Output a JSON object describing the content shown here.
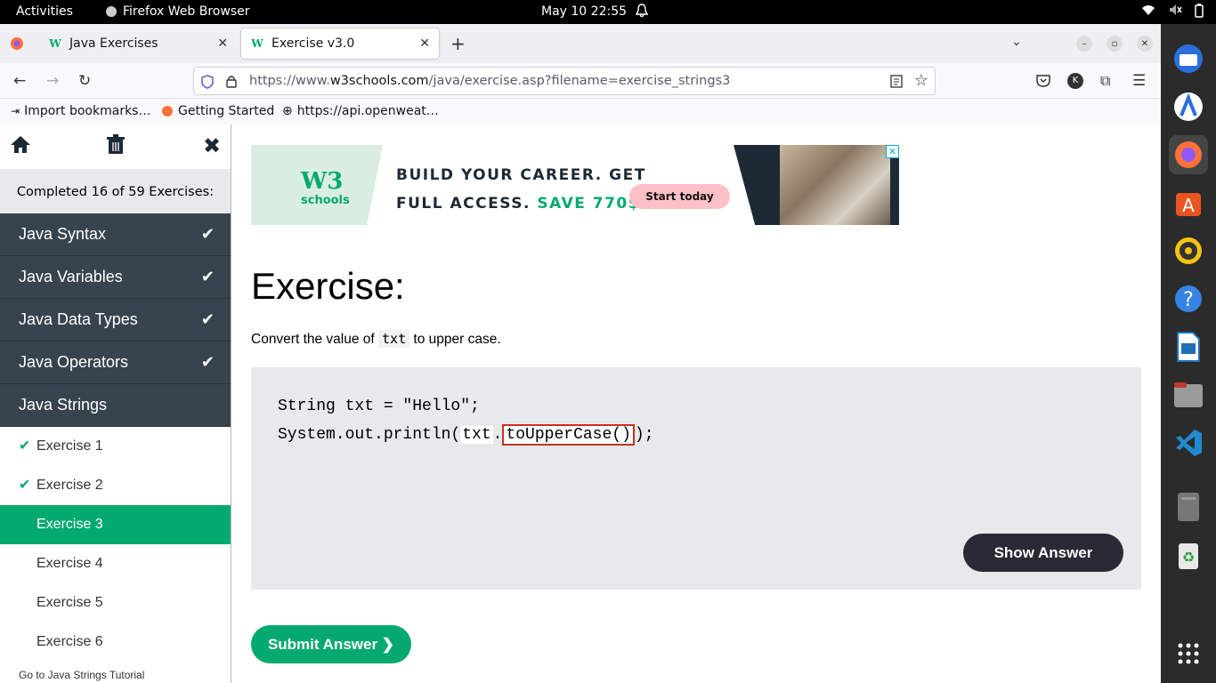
{
  "topbar": {
    "activities": "Activities",
    "app_name": "Firefox Web Browser",
    "clock": "May 10  22:55"
  },
  "tabs": [
    {
      "title": "Java Exercises",
      "favicon": "W"
    },
    {
      "title": "Exercise v3.0",
      "favicon": "W"
    }
  ],
  "url": {
    "prefix": "https://www.",
    "domain": "w3schools.com",
    "path": "/java/exercise.asp?filename=exercise_strings3"
  },
  "bookmarks": [
    "Import bookmarks…",
    "Getting Started",
    "https://api.openweat…"
  ],
  "sidebar": {
    "completed": "Completed 16 of 59 Exercises:",
    "categories": [
      {
        "label": "Java Syntax",
        "done": "✔"
      },
      {
        "label": "Java Variables",
        "done": "✔"
      },
      {
        "label": "Java Data Types",
        "done": "✔"
      },
      {
        "label": "Java Operators",
        "done": "✔"
      },
      {
        "label": "Java Strings"
      }
    ],
    "exercises": [
      "Exercise 1",
      "Exercise 2",
      "Exercise 3",
      "Exercise 4",
      "Exercise 5",
      "Exercise 6"
    ],
    "goto": "Go to Java Strings Tutorial"
  },
  "ad": {
    "w3": "W3",
    "schools": "schools",
    "line1": "BUILD YOUR CAREER. GET",
    "line2": "FULL ACCESS.",
    "save": "SAVE 770$",
    "cta": "Start today"
  },
  "exercise": {
    "heading": "Exercise:",
    "instr_before": "Convert the value of ",
    "instr_code": "txt",
    "instr_after": " to upper case.",
    "line1": "String txt = \"Hello\";",
    "line2_a": "System.out.println(",
    "line2_b": "txt",
    "line2_c": ".",
    "answer": "toUpperCase()",
    "line2_d": ");",
    "show_answer": "Show Answer",
    "submit": "Submit Answer ❯"
  }
}
